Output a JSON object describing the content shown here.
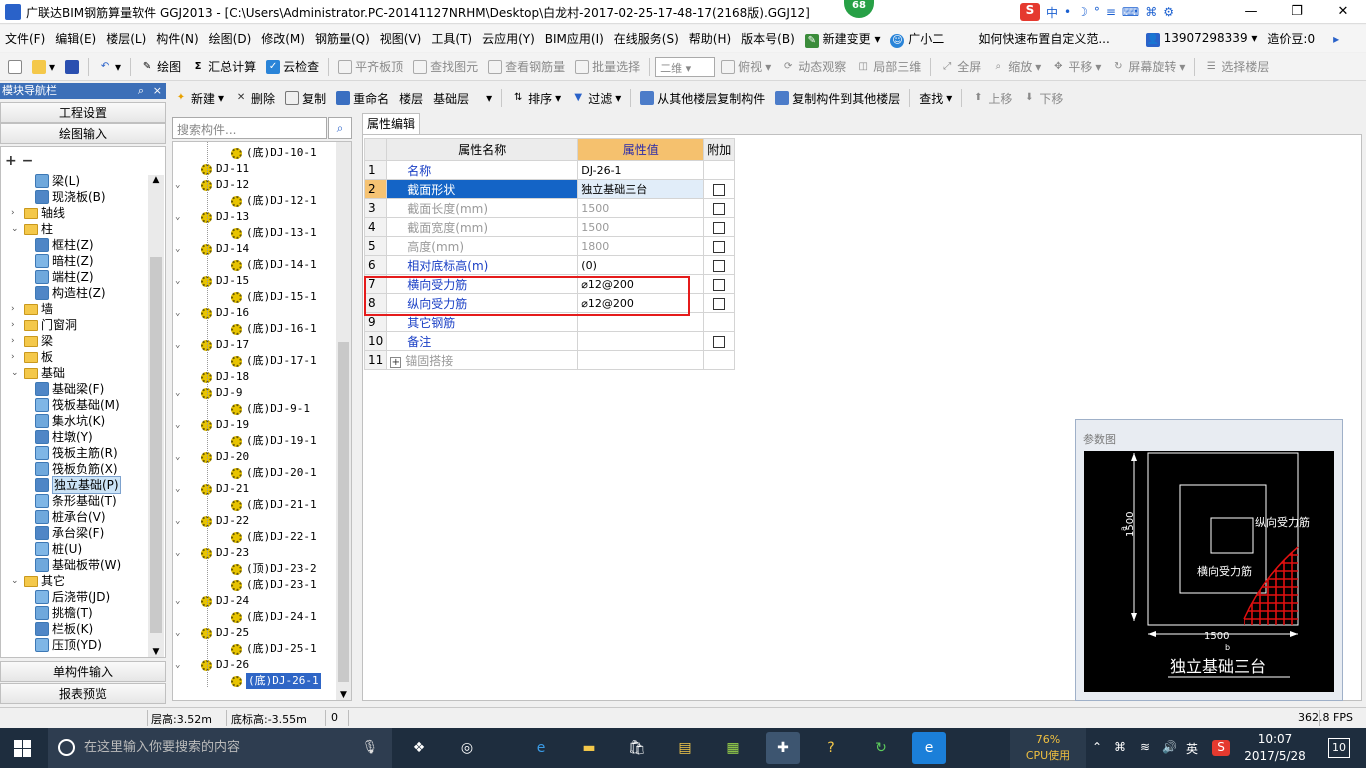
{
  "window": {
    "title": "广联达BIM钢筋算量软件 GGJ2013 - [C:\\Users\\Administrator.PC-20141127NRHM\\Desktop\\白龙村-2017-02-25-17-48-17(2168版).GGJ12]",
    "badge": "68",
    "ime_items": [
      "中",
      "•",
      "☽",
      "°",
      "≡",
      "⌨",
      "⌘",
      "⚙"
    ],
    "controls": {
      "minimize": "—",
      "restore": "❐",
      "close": "✕"
    }
  },
  "menubar": {
    "items": [
      "文件(F)",
      "编辑(E)",
      "楼层(L)",
      "构件(N)",
      "绘图(D)",
      "修改(M)",
      "钢筋量(Q)",
      "视图(V)",
      "工具(T)",
      "云应用(Y)",
      "BIM应用(I)",
      "在线服务(S)",
      "帮助(H)",
      "版本号(B)",
      "新建变更",
      "广小二"
    ],
    "help_link": "如何快速布置自定义范...",
    "phone": "13907298339",
    "beans": "造价豆:0"
  },
  "toolbar1": {
    "draw": "绘图",
    "sum": "汇总计算",
    "cloud_check": "云检查",
    "flat_slab": "平齐板顶",
    "find_elem": "查找图元",
    "view_rebar": "查看钢筋量",
    "batch_select": "批量选择",
    "view_mode": "二维",
    "top_view": "俯视",
    "dynamic_view": "动态观察",
    "partial_3d": "局部三维",
    "fullscreen": "全屏",
    "zoom": "缩放",
    "pan": "平移",
    "screen_rotate": "屏幕旋转",
    "select_floor": "选择楼层"
  },
  "toolbar2": {
    "new": "新建",
    "delete": "删除",
    "copy": "复制",
    "rename": "重命名",
    "floor_label": "楼层",
    "floor_value": "基础层",
    "sort": "排序",
    "filter": "过滤",
    "copy_from": "从其他楼层复制构件",
    "copy_to": "复制构件到其他楼层",
    "find": "查找",
    "move_up": "上移",
    "move_down": "下移"
  },
  "nav": {
    "title": "模块导航栏",
    "pin": "⌕",
    "close": "×",
    "btn_project": "工程设置",
    "btn_draw_input": "绘图输入",
    "btn_single_input": "单构件输入",
    "btn_report": "报表预览",
    "tree": [
      {
        "label": "梁(L)",
        "level": 2,
        "kind": "item"
      },
      {
        "label": "现浇板(B)",
        "level": 2,
        "kind": "item"
      },
      {
        "label": "轴线",
        "level": 1,
        "kind": "folder",
        "exp": "›"
      },
      {
        "label": "柱",
        "level": 1,
        "kind": "folder",
        "exp": "⌄"
      },
      {
        "label": "框柱(Z)",
        "level": 2,
        "kind": "item"
      },
      {
        "label": "暗柱(Z)",
        "level": 2,
        "kind": "item"
      },
      {
        "label": "端柱(Z)",
        "level": 2,
        "kind": "item"
      },
      {
        "label": "构造柱(Z)",
        "level": 2,
        "kind": "item"
      },
      {
        "label": "墙",
        "level": 1,
        "kind": "folder",
        "exp": "›"
      },
      {
        "label": "门窗洞",
        "level": 1,
        "kind": "folder",
        "exp": "›"
      },
      {
        "label": "梁",
        "level": 1,
        "kind": "folder",
        "exp": "›"
      },
      {
        "label": "板",
        "level": 1,
        "kind": "folder",
        "exp": "›"
      },
      {
        "label": "基础",
        "level": 1,
        "kind": "folder",
        "exp": "⌄"
      },
      {
        "label": "基础梁(F)",
        "level": 2,
        "kind": "item"
      },
      {
        "label": "筏板基础(M)",
        "level": 2,
        "kind": "item"
      },
      {
        "label": "集水坑(K)",
        "level": 2,
        "kind": "item"
      },
      {
        "label": "柱墩(Y)",
        "level": 2,
        "kind": "item"
      },
      {
        "label": "筏板主筋(R)",
        "level": 2,
        "kind": "item"
      },
      {
        "label": "筏板负筋(X)",
        "level": 2,
        "kind": "item"
      },
      {
        "label": "独立基础(P)",
        "level": 2,
        "kind": "item",
        "selected": true
      },
      {
        "label": "条形基础(T)",
        "level": 2,
        "kind": "item"
      },
      {
        "label": "桩承台(V)",
        "level": 2,
        "kind": "item"
      },
      {
        "label": "承台梁(F)",
        "level": 2,
        "kind": "item"
      },
      {
        "label": "桩(U)",
        "level": 2,
        "kind": "item"
      },
      {
        "label": "基础板带(W)",
        "level": 2,
        "kind": "item"
      },
      {
        "label": "其它",
        "level": 1,
        "kind": "folder",
        "exp": "⌄"
      },
      {
        "label": "后浇带(JD)",
        "level": 2,
        "kind": "item"
      },
      {
        "label": "挑檐(T)",
        "level": 2,
        "kind": "item"
      },
      {
        "label": "栏板(K)",
        "level": 2,
        "kind": "item"
      },
      {
        "label": "压顶(YD)",
        "level": 2,
        "kind": "item"
      }
    ]
  },
  "component_tree": {
    "search_placeholder": "搜索构件...",
    "items": [
      {
        "label": "(底)DJ-10-1",
        "level": 2
      },
      {
        "label": "DJ-11",
        "level": 1,
        "leaf": true
      },
      {
        "label": "DJ-12",
        "level": 1
      },
      {
        "label": "(底)DJ-12-1",
        "level": 2
      },
      {
        "label": "DJ-13",
        "level": 1
      },
      {
        "label": "(底)DJ-13-1",
        "level": 2
      },
      {
        "label": "DJ-14",
        "level": 1
      },
      {
        "label": "(底)DJ-14-1",
        "level": 2
      },
      {
        "label": "DJ-15",
        "level": 1
      },
      {
        "label": "(底)DJ-15-1",
        "level": 2
      },
      {
        "label": "DJ-16",
        "level": 1
      },
      {
        "label": "(底)DJ-16-1",
        "level": 2
      },
      {
        "label": "DJ-17",
        "level": 1
      },
      {
        "label": "(底)DJ-17-1",
        "level": 2
      },
      {
        "label": "DJ-18",
        "level": 1,
        "leaf": true
      },
      {
        "label": "DJ-9",
        "level": 1
      },
      {
        "label": "(底)DJ-9-1",
        "level": 2
      },
      {
        "label": "DJ-19",
        "level": 1
      },
      {
        "label": "(底)DJ-19-1",
        "level": 2
      },
      {
        "label": "DJ-20",
        "level": 1
      },
      {
        "label": "(底)DJ-20-1",
        "level": 2
      },
      {
        "label": "DJ-21",
        "level": 1
      },
      {
        "label": "(底)DJ-21-1",
        "level": 2
      },
      {
        "label": "DJ-22",
        "level": 1
      },
      {
        "label": "(底)DJ-22-1",
        "level": 2
      },
      {
        "label": "DJ-23",
        "level": 1
      },
      {
        "label": "(顶)DJ-23-2",
        "level": 2
      },
      {
        "label": "(底)DJ-23-1",
        "level": 2
      },
      {
        "label": "DJ-24",
        "level": 1
      },
      {
        "label": "(底)DJ-24-1",
        "level": 2
      },
      {
        "label": "DJ-25",
        "level": 1
      },
      {
        "label": "(底)DJ-25-1",
        "level": 2
      },
      {
        "label": "DJ-26",
        "level": 1
      },
      {
        "label": "(底)DJ-26-1",
        "level": 2,
        "selected": true
      }
    ]
  },
  "property_panel": {
    "tab": "属性编辑",
    "headers": {
      "name": "属性名称",
      "value": "属性值",
      "extra": "附加"
    },
    "rows": [
      {
        "num": "1",
        "name": "名称",
        "value": "DJ-26-1",
        "checkbox": false,
        "gray": false
      },
      {
        "num": "2",
        "name": "截面形状",
        "value": "独立基础三台",
        "checkbox": true,
        "gray": false,
        "selected": true
      },
      {
        "num": "3",
        "name": "截面长度(mm)",
        "value": "1500",
        "checkbox": true,
        "gray": true
      },
      {
        "num": "4",
        "name": "截面宽度(mm)",
        "value": "1500",
        "checkbox": true,
        "gray": true
      },
      {
        "num": "5",
        "name": "高度(mm)",
        "value": "1800",
        "checkbox": true,
        "gray": true
      },
      {
        "num": "6",
        "name": "相对底标高(m)",
        "value": "(0)",
        "checkbox": true,
        "gray": false
      },
      {
        "num": "7",
        "name": "横向受力筋",
        "value": "⌀12@200",
        "checkbox": true,
        "gray": false
      },
      {
        "num": "8",
        "name": "纵向受力筋",
        "value": "⌀12@200",
        "checkbox": true,
        "gray": false
      },
      {
        "num": "9",
        "name": "其它钢筋",
        "value": "",
        "checkbox": false,
        "gray": false
      },
      {
        "num": "10",
        "name": "备注",
        "value": "",
        "checkbox": true,
        "gray": false
      },
      {
        "num": "11",
        "name": "锚固搭接",
        "value": "",
        "checkbox": false,
        "gray": true,
        "expander": "+"
      }
    ]
  },
  "param_diagram": {
    "title": "参数图",
    "label_longitudinal": "纵向受力筋",
    "label_transverse": "横向受力筋",
    "dim_height": "1500",
    "dim_height_sub": "a",
    "dim_width": "1500",
    "dim_width_sub": "b",
    "caption": "独立基础三台",
    "colors": {
      "background": "#000000",
      "lines": "#ffffff",
      "hatch": "#e01010"
    }
  },
  "status": {
    "floor_height": "层高:3.52m",
    "bottom_elev": "底标高:-3.55m",
    "value": "0",
    "fps": "362.8 FPS"
  },
  "taskbar": {
    "search_placeholder": "在这里输入你要搜索的内容",
    "cpu_percent": "76%",
    "cpu_label": "CPU使用",
    "ime": "英",
    "time": "10:07",
    "date": "2017/5/28",
    "notifications": "10"
  }
}
